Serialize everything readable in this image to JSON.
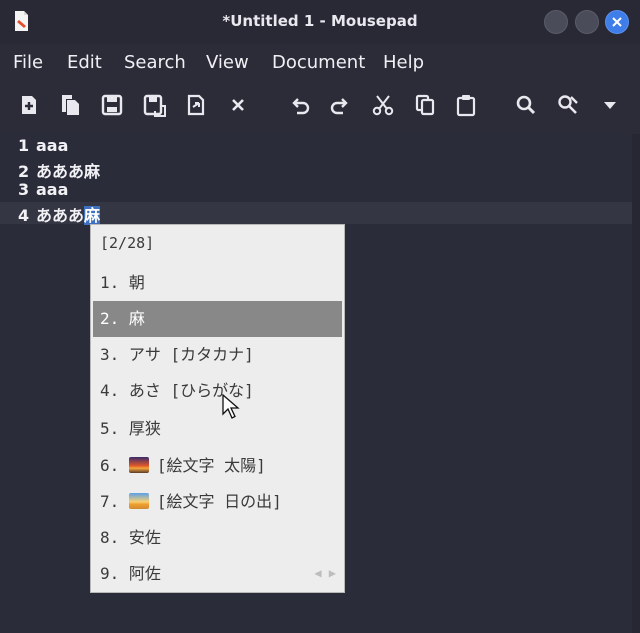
{
  "window": {
    "title": "*Untitled 1 - Mousepad"
  },
  "menu": [
    "File",
    "Edit",
    "Search",
    "View",
    "Document",
    "Help"
  ],
  "toolbar": {
    "icons": [
      "new-document-icon",
      "new-window-icon",
      "save-icon",
      "save-as-icon",
      "revert-icon",
      "close-document-icon",
      "undo-icon",
      "redo-icon",
      "cut-icon",
      "copy-icon",
      "paste-icon",
      "find-icon",
      "find-replace-icon",
      "overflow-dropdown-icon"
    ]
  },
  "editor": {
    "lines": [
      {
        "number": "1",
        "text": "aaa"
      },
      {
        "number": "2",
        "text": "あああ麻"
      },
      {
        "number": "3",
        "text": "aaa"
      },
      {
        "number": "4",
        "text": "あああ",
        "preedit": "麻"
      }
    ]
  },
  "ime": {
    "header": "[2/28]",
    "candidates": [
      {
        "index": "1.",
        "text": "朝"
      },
      {
        "index": "2.",
        "text": "麻",
        "selected": true
      },
      {
        "index": "3.",
        "text": "アサ [カタカナ]"
      },
      {
        "index": "4.",
        "text": "あさ [ひらがな]"
      },
      {
        "index": "5.",
        "text": "厚狭"
      },
      {
        "index": "6.",
        "emoji": "sunset",
        "text": "[絵文字 太陽]"
      },
      {
        "index": "7.",
        "emoji": "sunrise",
        "text": "[絵文字 日の出]"
      },
      {
        "index": "8.",
        "text": "安佐"
      },
      {
        "index": "9.",
        "text": "阿佐"
      }
    ],
    "pager": "◀ ▶"
  },
  "colors": {
    "selection": "#3f70c0",
    "close_button": "#3f7ee8",
    "selected_candidate": "#888888"
  }
}
